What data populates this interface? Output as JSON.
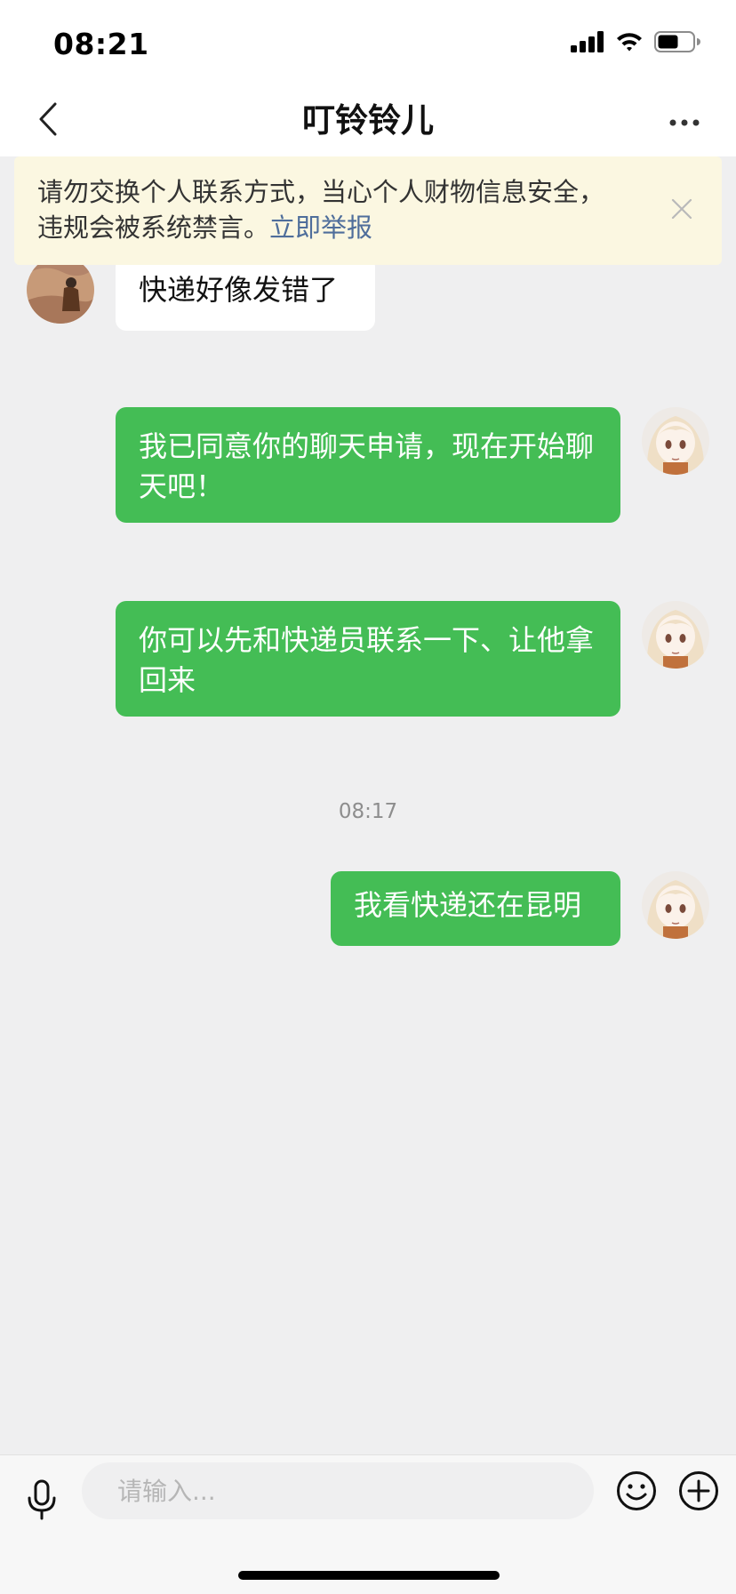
{
  "status_bar": {
    "time": "08:21"
  },
  "nav": {
    "title": "叮铃铃儿"
  },
  "notice": {
    "text": "请勿交换个人联系方式，当心个人财物信息安全，违规会被系统禁言。",
    "link_label": "立即举报"
  },
  "messages": [
    {
      "side": "incoming",
      "text": "快递好像发错了"
    },
    {
      "side": "outgoing",
      "text": "我已同意你的聊天申请，现在开始聊天吧！"
    },
    {
      "side": "outgoing",
      "text": "你可以先和快递员联系一下、让他拿回来"
    },
    {
      "side": "divider",
      "text": "08:17"
    },
    {
      "side": "outgoing",
      "text": "我看快递还在昆明"
    }
  ],
  "input": {
    "placeholder": "请输入..."
  },
  "colors": {
    "outgoing_bubble": "#44bd55",
    "incoming_bubble": "#ffffff",
    "notice_background": "#fbf7e1",
    "notice_link": "#4f6e9b",
    "chat_background": "#efeff0"
  },
  "icons": {
    "status": [
      "signal-icon",
      "wifi-icon",
      "battery-icon"
    ],
    "nav": [
      "back-arrow-icon",
      "more-icon"
    ],
    "notice": [
      "close-icon"
    ],
    "input_bar": [
      "microphone-icon",
      "emoji-icon",
      "plus-icon"
    ]
  }
}
